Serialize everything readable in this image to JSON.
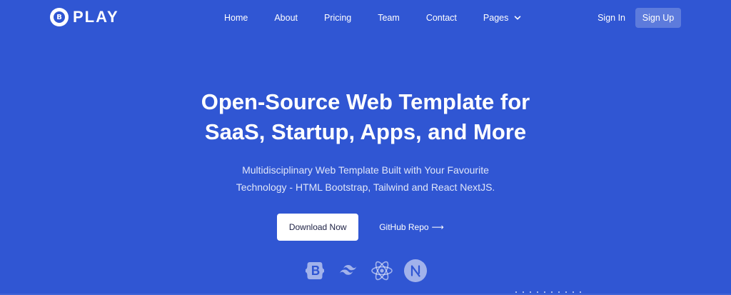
{
  "brand": {
    "logo_letter": "B",
    "name": "PLAY"
  },
  "nav": {
    "items": [
      {
        "label": "Home"
      },
      {
        "label": "About"
      },
      {
        "label": "Pricing"
      },
      {
        "label": "Team"
      },
      {
        "label": "Contact"
      },
      {
        "label": "Pages",
        "icon": "chevron-down-icon"
      }
    ]
  },
  "auth": {
    "signin_label": "Sign In",
    "signup_label": "Sign Up"
  },
  "hero": {
    "title_line1": "Open-Source Web Template for",
    "title_line2": "SaaS, Startup, Apps, and More",
    "subtitle_line1": "Multidisciplinary Web Template Built with Your Favourite",
    "subtitle_line2": "Technology - HTML Bootstrap, Tailwind and React NextJS.",
    "download_label": "Download Now",
    "github_label": "GitHub Repo",
    "github_arrow": "⟶"
  },
  "tech_icons": [
    {
      "icon": "bootstrap-icon"
    },
    {
      "icon": "tailwind-icon"
    },
    {
      "icon": "react-icon"
    },
    {
      "icon": "nextjs-icon"
    }
  ],
  "colors": {
    "background": "#3056d3",
    "text": "#ffffff",
    "button_text": "#1d2144"
  }
}
